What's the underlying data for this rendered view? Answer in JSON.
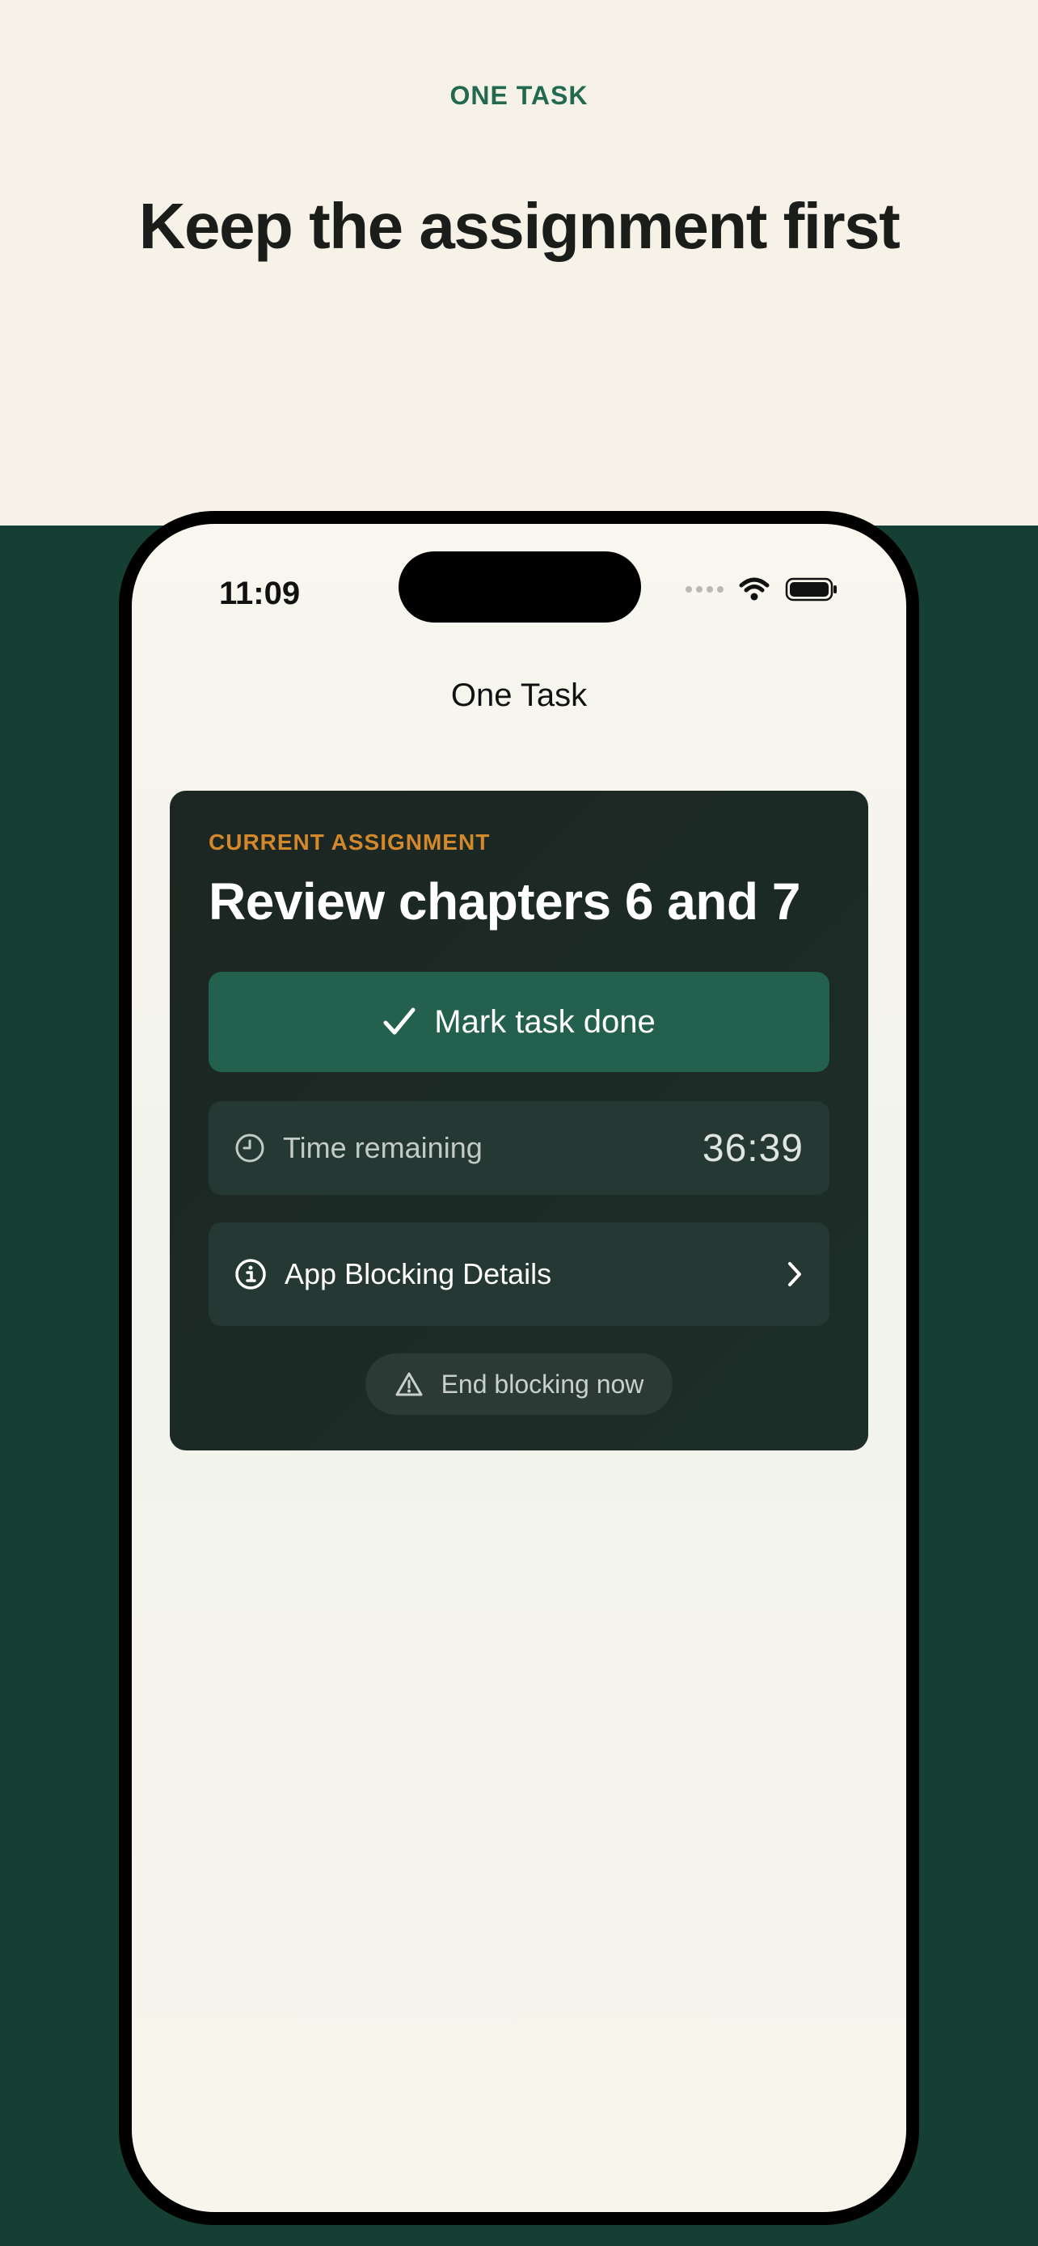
{
  "marketing": {
    "eyebrow": "ONE TASK",
    "headline": "Keep the assignment first"
  },
  "status_bar": {
    "time": "11:09",
    "icons": [
      "cellular-dots-icon",
      "wifi-icon",
      "battery-icon"
    ]
  },
  "nav": {
    "title": "One Task"
  },
  "assignment_card": {
    "label": "CURRENT ASSIGNMENT",
    "title": "Review chapters 6 and 7",
    "done_button_label": "Mark task done",
    "time_remaining_label": "Time remaining",
    "time_remaining_value": "36:39",
    "app_blocking_label": "App Blocking Details",
    "end_blocking_label": "End blocking now"
  },
  "colors": {
    "background_cream": "#f6f2e8",
    "background_green": "#163f34",
    "accent_green": "#22694f",
    "label_orange": "#d4882c",
    "card_dark": "#1c2622",
    "button_green": "#23604d"
  }
}
